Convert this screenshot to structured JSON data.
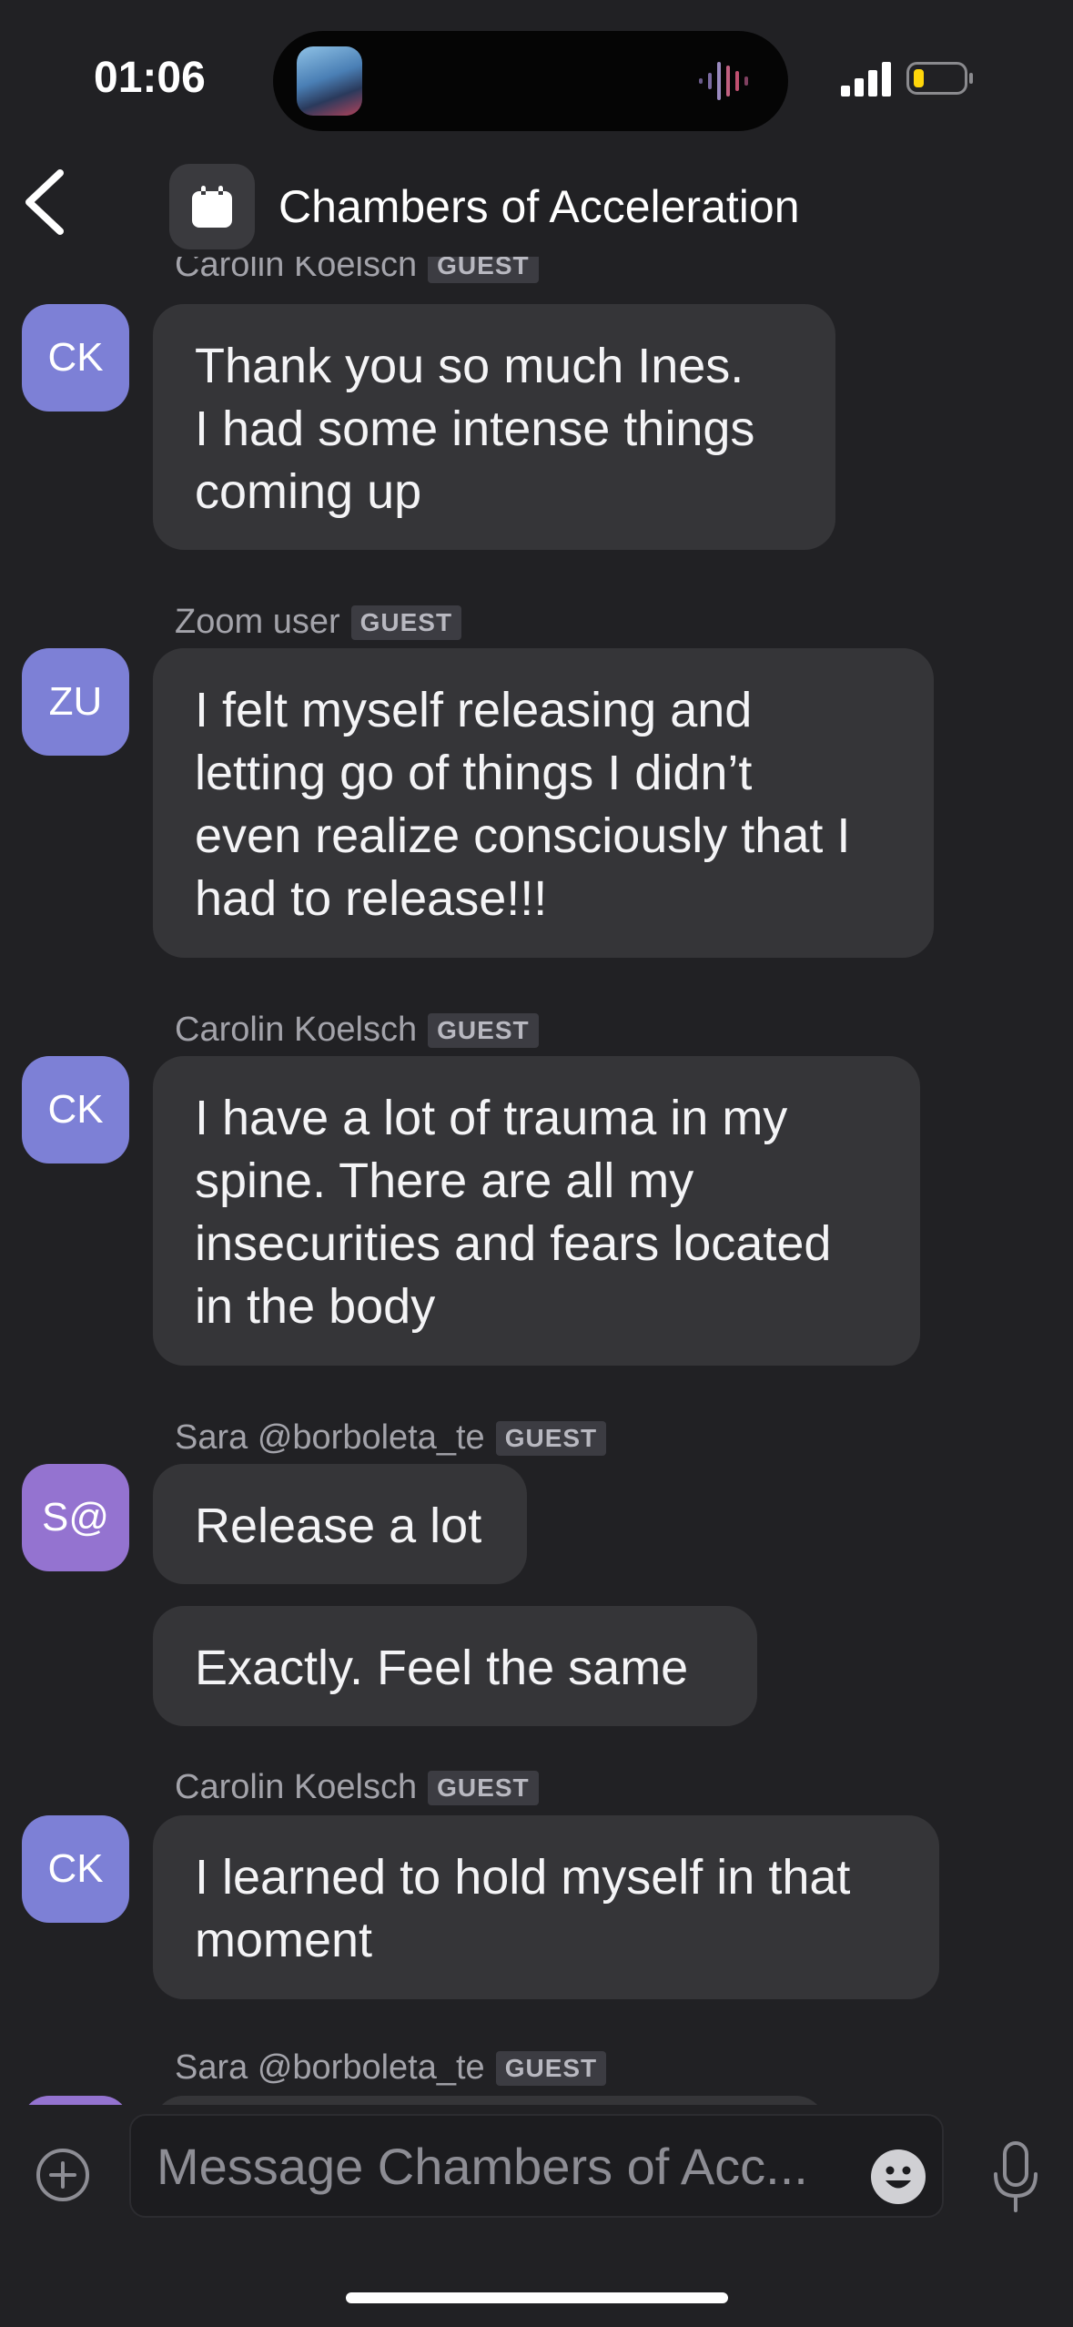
{
  "status_bar": {
    "time": "01:06"
  },
  "header": {
    "title": "Chambers of Acceleration"
  },
  "messages": [
    {
      "sender": "Carolin Koelsch",
      "badge": "GUEST",
      "initials": "CK",
      "text": "Thank you so much Ines.\nI had some intense things\ncoming up"
    },
    {
      "sender": "Zoom user",
      "badge": "GUEST",
      "initials": "ZU",
      "text": "I felt myself releasing and\nletting go of things I didn’t\neven realize consciously that I\nhad to release!!!"
    },
    {
      "sender": "Carolin Koelsch",
      "badge": "GUEST",
      "initials": "CK",
      "text": "I have a lot of trauma in my\nspine. There are all my\ninsecurities and fears located\nin the body"
    },
    {
      "sender": "Sara @borboleta_te",
      "badge": "GUEST",
      "initials": "S@",
      "text": "Release a lot"
    },
    {
      "text": "Exactly. Feel the same"
    },
    {
      "sender": "Carolin Koelsch",
      "badge": "GUEST",
      "initials": "CK",
      "text": "I learned to hold myself in that\nmoment"
    },
    {
      "sender": "Sara @borboleta_te",
      "badge": "GUEST"
    }
  ],
  "composer": {
    "placeholder": "Message Chambers of Acc..."
  },
  "colors": {
    "background": "#212124",
    "bubble": "#353538",
    "avatar_blue": "#7d80d6",
    "avatar_purple": "#9473d0"
  }
}
